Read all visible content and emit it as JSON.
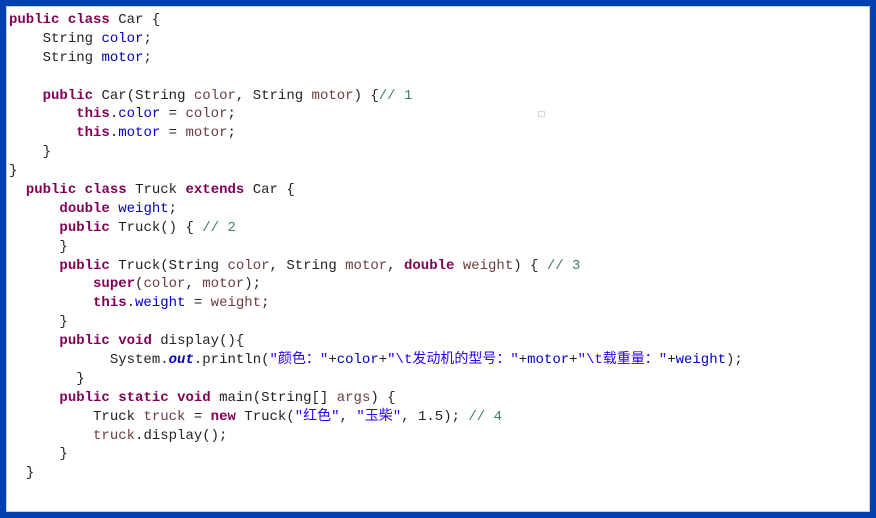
{
  "code": {
    "kw_public": "public",
    "kw_class": "class",
    "kw_void": "void",
    "kw_this": "this",
    "kw_super": "super",
    "kw_extends": "extends",
    "kw_double": "double",
    "kw_static": "static",
    "kw_new": "new",
    "cls_Car": "Car",
    "cls_Truck": "Truck",
    "cls_String": "String",
    "cls_System": "System",
    "field_color": "color",
    "field_motor": "motor",
    "field_weight": "weight",
    "field_out": "out",
    "method_Truck": "Truck",
    "method_display": "display",
    "method_println": "println",
    "method_main": "main",
    "method_displayCall": "display",
    "param_color": "color",
    "param_motor": "motor",
    "param_weight": "weight",
    "param_args": "args",
    "var_truck": "truck",
    "comment_1": "// 1",
    "comment_2": "// 2",
    "comment_3": "// 3",
    "comment_4": "// 4",
    "str_color_label": "\"颜色：\"",
    "str_motor_label": "\"\\t发动机的型号：\"",
    "str_weight_label": "\"\\t载重量：\"",
    "str_red": "\"红色\"",
    "str_yuchai": "\"玉柴\"",
    "num_1_5": "1.5"
  }
}
